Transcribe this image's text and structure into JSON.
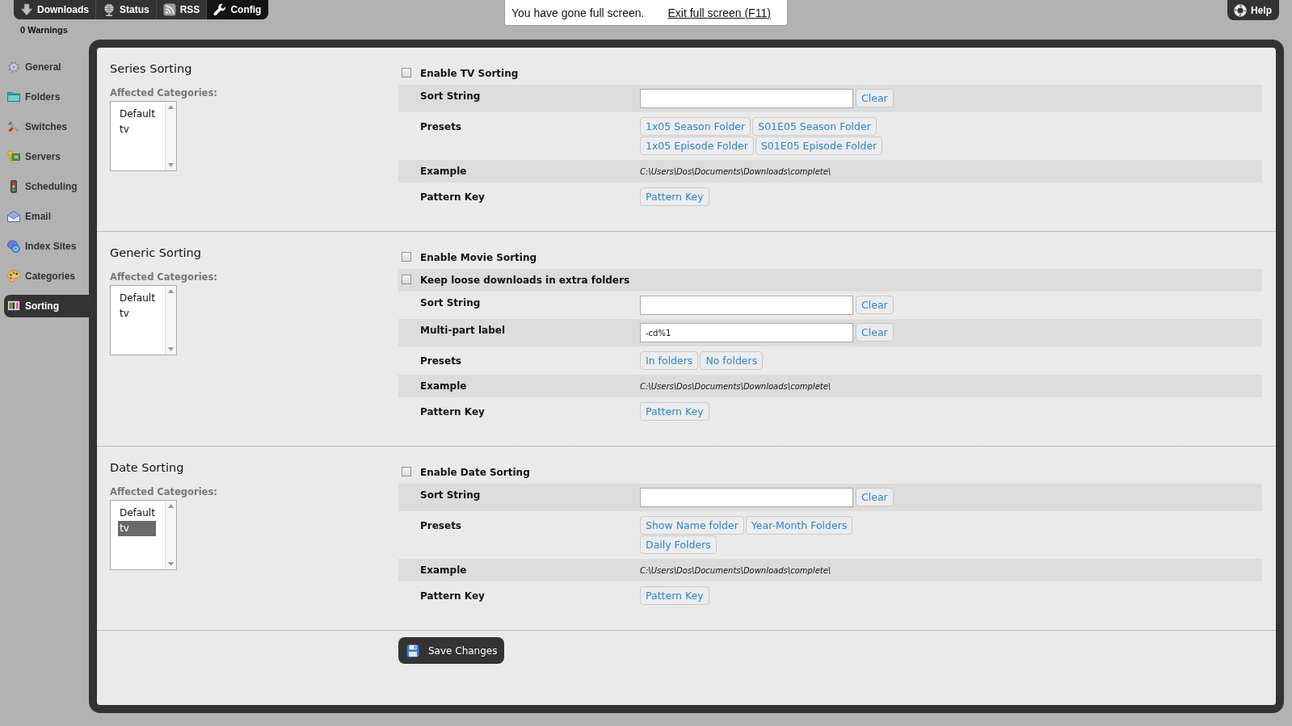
{
  "nav": {
    "tabs": [
      {
        "label": "Downloads",
        "selected": false
      },
      {
        "label": "Status",
        "selected": false
      },
      {
        "label": "RSS",
        "selected": false
      },
      {
        "label": "Config",
        "selected": true
      }
    ]
  },
  "warnings": "0 Warnings",
  "fullscreen_notice": {
    "message": "You have gone full screen.",
    "link": "Exit full screen (F11)"
  },
  "help_button": "Help",
  "sidebar": {
    "items": [
      {
        "label": "General",
        "selected": false
      },
      {
        "label": "Folders",
        "selected": false
      },
      {
        "label": "Switches",
        "selected": false
      },
      {
        "label": "Servers",
        "selected": false
      },
      {
        "label": "Scheduling",
        "selected": false
      },
      {
        "label": "Email",
        "selected": false
      },
      {
        "label": "Index Sites",
        "selected": false
      },
      {
        "label": "Categories",
        "selected": false
      },
      {
        "label": "Sorting",
        "selected": true
      }
    ]
  },
  "sections": [
    {
      "title": "Series Sorting",
      "categories_label": "Affected Categories:",
      "categories": [
        {
          "label": "Default",
          "selected": false
        },
        {
          "label": "tv",
          "selected": false
        }
      ],
      "rows": [
        {
          "kind": "checkbox",
          "label": "Enable TV Sorting",
          "checked": false
        },
        {
          "kind": "field",
          "label": "Sort String",
          "button": "Clear"
        },
        {
          "kind": "presets",
          "label": "Presets",
          "lines": [
            [
              "1x05 Season Folder",
              "S01E05 Season Folder"
            ],
            [
              "1x05 Episode Folder",
              "S01E05 Episode Folder"
            ]
          ]
        },
        {
          "kind": "example",
          "label": "Example",
          "value": "C:\\Users\\Dos\\Documents\\Downloads\\complete\\"
        },
        {
          "kind": "key",
          "label": "Pattern Key",
          "button": "Pattern Key"
        }
      ]
    },
    {
      "title": "Generic Sorting",
      "categories_label": "Affected Categories:",
      "categories": [
        {
          "label": "Default",
          "selected": false
        },
        {
          "label": "tv",
          "selected": false
        }
      ],
      "rows": [
        {
          "kind": "checkbox",
          "label": "Enable Movie Sorting",
          "checked": false
        },
        {
          "kind": "checkbox",
          "label": "Keep loose downloads in extra folders",
          "checked": false
        },
        {
          "kind": "field",
          "label": "Sort String",
          "button": "Clear"
        },
        {
          "kind": "field",
          "label": "Multi-part label",
          "value": "-cd%1",
          "button": "Clear"
        },
        {
          "kind": "presets",
          "label": "Presets",
          "lines": [
            [
              "In folders",
              "No folders"
            ]
          ]
        },
        {
          "kind": "example",
          "label": "Example",
          "value": "C:\\Users\\Dos\\Documents\\Downloads\\complete\\"
        },
        {
          "kind": "key",
          "label": "Pattern Key",
          "button": "Pattern Key"
        }
      ]
    },
    {
      "title": "Date Sorting",
      "categories_label": "Affected Categories:",
      "categories": [
        {
          "label": "Default",
          "selected": false
        },
        {
          "label": "tv",
          "selected": true
        }
      ],
      "rows": [
        {
          "kind": "checkbox",
          "label": "Enable Date Sorting",
          "checked": false
        },
        {
          "kind": "field",
          "label": "Sort String",
          "button": "Clear"
        },
        {
          "kind": "presets",
          "label": "Presets",
          "lines": [
            [
              "Show Name folder",
              "Year-Month Folders"
            ],
            [
              "Daily Folders"
            ]
          ]
        },
        {
          "kind": "example",
          "label": "Example",
          "value": "C:\\Users\\Dos\\Documents\\Downloads\\complete\\"
        },
        {
          "kind": "key",
          "label": "Pattern Key",
          "button": "Pattern Key"
        }
      ]
    }
  ],
  "save_button": "Save Changes"
}
